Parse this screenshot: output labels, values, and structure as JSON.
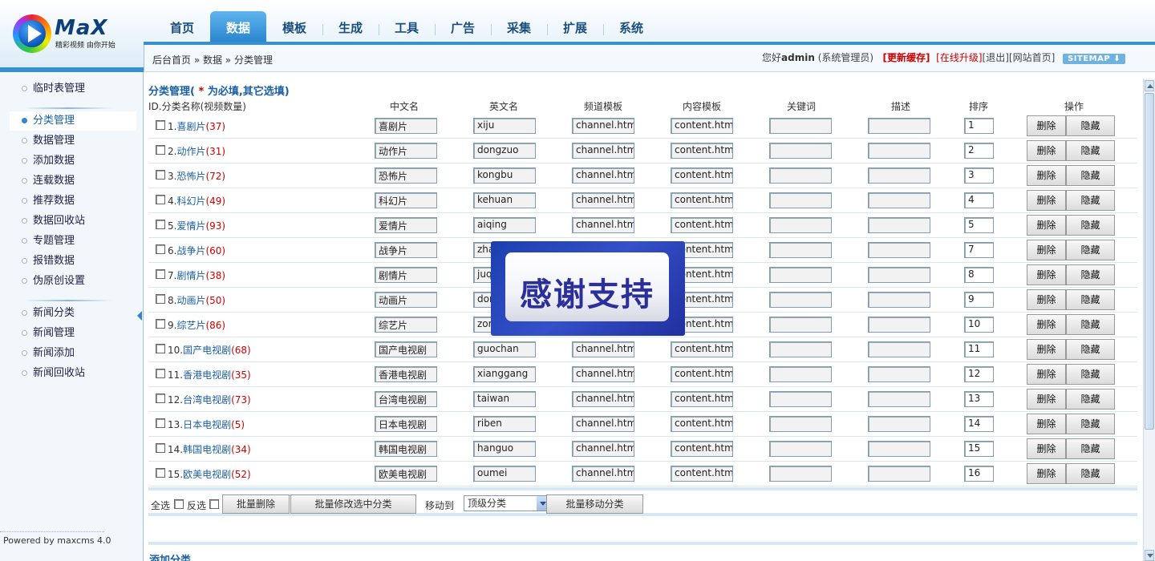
{
  "logo": {
    "brand": "MaX",
    "slogan": "精彩视频 由你开始"
  },
  "nav": [
    "首页",
    "数据",
    "模板",
    "生成",
    "工具",
    "广告",
    "采集",
    "扩展",
    "系统"
  ],
  "breadcrumb": "后台首页 » 数据 » 分类管理",
  "userbar": {
    "greeting": "您好",
    "username": "admin",
    "role": "(系统管理员)",
    "refresh_cache": "[更新缓存]",
    "upgrade": "[在线升级]",
    "logout": "[退出]",
    "site_home": "[网站首页]",
    "sitemap": "SITEMAP"
  },
  "sidebar": {
    "group1": [
      "临时表管理"
    ],
    "group2": [
      "分类管理",
      "数据管理",
      "添加数据",
      "连载数据",
      "推荐数据",
      "数据回收站",
      "专题管理",
      "报错数据",
      "伪原创设置"
    ],
    "group3": [
      "新闻分类",
      "新闻管理",
      "新闻添加",
      "新闻回收站"
    ],
    "active": "分类管理",
    "powered": "Powered by maxcms 4.0"
  },
  "section": {
    "title_prefix": "分类管理(",
    "star": "*",
    "title_suffix": "为必填,其它选填)"
  },
  "columns": [
    "ID.分类名称(视频数量)",
    "中文名",
    "英文名",
    "频道模板",
    "内容模板",
    "关键词",
    "描述",
    "排序",
    "操作"
  ],
  "rows": [
    {
      "id": "1.",
      "name": "喜剧片",
      "count": "(37)",
      "cn": "喜剧片",
      "en": "xiju",
      "channel": "channel.htm",
      "content": "content.htm",
      "keywords": "",
      "desc": "",
      "order": "1"
    },
    {
      "id": "2.",
      "name": "动作片",
      "count": "(31)",
      "cn": "动作片",
      "en": "dongzuo",
      "channel": "channel.htm",
      "content": "content.htm",
      "keywords": "",
      "desc": "",
      "order": "2"
    },
    {
      "id": "3.",
      "name": "恐怖片",
      "count": "(72)",
      "cn": "恐怖片",
      "en": "kongbu",
      "channel": "channel.htm",
      "content": "content.htm",
      "keywords": "",
      "desc": "",
      "order": "3"
    },
    {
      "id": "4.",
      "name": "科幻片",
      "count": "(49)",
      "cn": "科幻片",
      "en": "kehuan",
      "channel": "channel.htm",
      "content": "content.htm",
      "keywords": "",
      "desc": "",
      "order": "4"
    },
    {
      "id": "5.",
      "name": "爱情片",
      "count": "(93)",
      "cn": "爱情片",
      "en": "aiqing",
      "channel": "channel.htm",
      "content": "content.htm",
      "keywords": "",
      "desc": "",
      "order": "5"
    },
    {
      "id": "6.",
      "name": "战争片",
      "count": "(60)",
      "cn": "战争片",
      "en": "zha",
      "channel": "",
      "content": "content.htm",
      "keywords": "",
      "desc": "",
      "order": "7"
    },
    {
      "id": "7.",
      "name": "剧情片",
      "count": "(38)",
      "cn": "剧情片",
      "en": "juq",
      "channel": "",
      "content": "content.htm",
      "keywords": "",
      "desc": "",
      "order": "8"
    },
    {
      "id": "8.",
      "name": "动画片",
      "count": "(50)",
      "cn": "动画片",
      "en": "don",
      "channel": "",
      "content": "content.htm",
      "keywords": "",
      "desc": "",
      "order": "9"
    },
    {
      "id": "9.",
      "name": "综艺片",
      "count": "(86)",
      "cn": "综艺片",
      "en": "zon",
      "channel": "",
      "content": "content.htm",
      "keywords": "",
      "desc": "",
      "order": "10"
    },
    {
      "id": "10.",
      "name": "国产电视剧",
      "count": "(68)",
      "cn": "国产电视剧",
      "en": "guochan",
      "channel": "channel.htm",
      "content": "content.htm",
      "keywords": "",
      "desc": "",
      "order": "11"
    },
    {
      "id": "11.",
      "name": "香港电视剧",
      "count": "(35)",
      "cn": "香港电视剧",
      "en": "xianggang",
      "channel": "channel.htm",
      "content": "content.htm",
      "keywords": "",
      "desc": "",
      "order": "12"
    },
    {
      "id": "12.",
      "name": "台湾电视剧",
      "count": "(73)",
      "cn": "台湾电视剧",
      "en": "taiwan",
      "channel": "channel.htm",
      "content": "content.htm",
      "keywords": "",
      "desc": "",
      "order": "13"
    },
    {
      "id": "13.",
      "name": "日本电视剧",
      "count": "(5)",
      "cn": "日本电视剧",
      "en": "riben",
      "channel": "channel.htm",
      "content": "content.htm",
      "keywords": "",
      "desc": "",
      "order": "14"
    },
    {
      "id": "14.",
      "name": "韩国电视剧",
      "count": "(34)",
      "cn": "韩国电视剧",
      "en": "hanguo",
      "channel": "channel.htm",
      "content": "content.htm",
      "keywords": "",
      "desc": "",
      "order": "15"
    },
    {
      "id": "15.",
      "name": "欧美电视剧",
      "count": "(52)",
      "cn": "欧美电视剧",
      "en": "oumei",
      "channel": "channel.htm",
      "content": "content.htm",
      "keywords": "",
      "desc": "",
      "order": "16"
    }
  ],
  "row_actions": {
    "delete": "删除",
    "hide": "隐藏"
  },
  "batch": {
    "select_all": "全选",
    "invert": "反选",
    "batch_delete": "批量删除",
    "batch_modify": "批量修改选中分类",
    "move_to": "移动到",
    "move_target": "顶级分类",
    "batch_move": "批量移动分类"
  },
  "add_section_title": "添加分类",
  "overlay_text": "感谢支持"
}
